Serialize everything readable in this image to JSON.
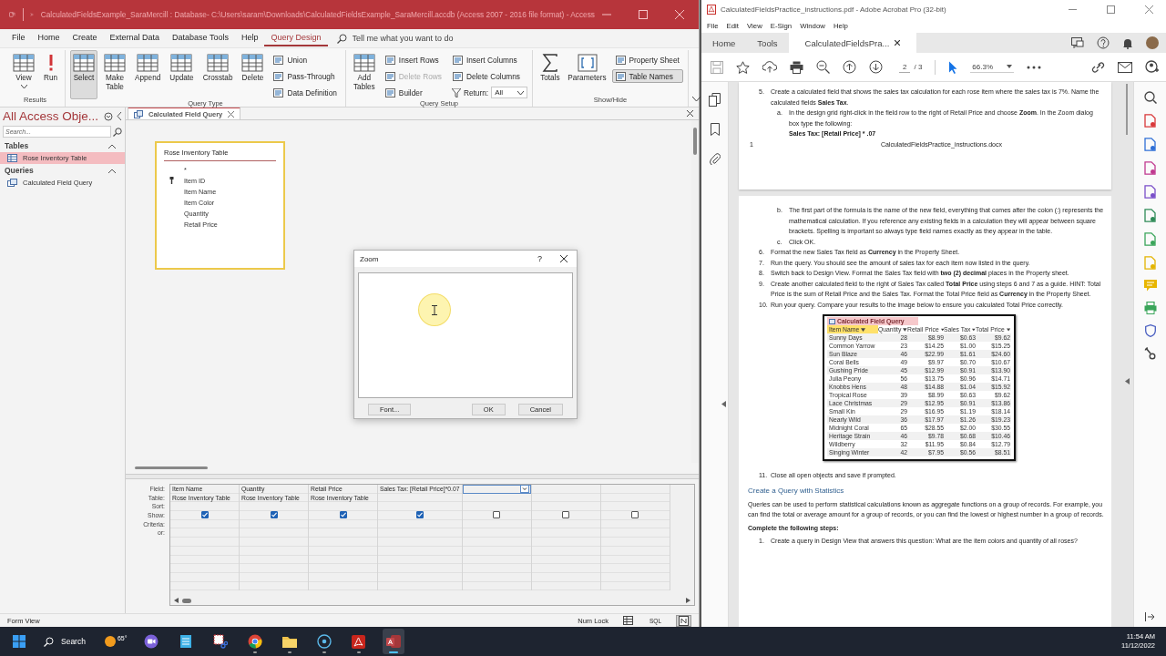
{
  "access": {
    "title": "CalculatedFieldsExample_SaraMercill : Database- C:\\Users\\saram\\Downloads\\CalculatedFieldsExample_SaraMercill.accdb (Access 2007 - 2016 file format)  -  Access",
    "ribbon_tabs": [
      {
        "label": "File",
        "selected": false
      },
      {
        "label": "Home",
        "selected": false
      },
      {
        "label": "Create",
        "selected": false
      },
      {
        "label": "External Data",
        "selected": false
      },
      {
        "label": "Database Tools",
        "selected": false
      },
      {
        "label": "Help",
        "selected": false
      },
      {
        "label": "Query Design",
        "selected": true
      }
    ],
    "tell_me": {
      "placeholder": "Tell me what you want to do"
    },
    "ribbon_groups": [
      {
        "label": "Results",
        "items": [
          {
            "label": "View",
            "kind": "view",
            "selected": false,
            "disabled": false
          },
          {
            "label": "Run",
            "kind": "alert",
            "selected": false,
            "disabled": false
          }
        ]
      },
      {
        "label": "Query Type",
        "items": [
          {
            "label": "Select",
            "kind": "grid",
            "selected": true,
            "disabled": false
          },
          {
            "label": "Make Table",
            "kind": "grid",
            "selected": false,
            "disabled": false
          },
          {
            "label": "Append",
            "kind": "grid",
            "selected": false,
            "disabled": false
          },
          {
            "label": "Update",
            "kind": "grid",
            "selected": false,
            "disabled": false
          },
          {
            "label": "Crosstab",
            "kind": "grid",
            "selected": false,
            "disabled": false
          },
          {
            "label": "Delete",
            "kind": "grid",
            "selected": false,
            "disabled": false
          },
          {
            "label": "Union",
            "kind": "small",
            "selected": false,
            "disabled": false
          },
          {
            "label": "Pass-Through",
            "kind": "small",
            "selected": false,
            "disabled": false
          },
          {
            "label": "Data Definition",
            "kind": "small",
            "selected": false,
            "disabled": false
          }
        ]
      },
      {
        "label": "Query Setup",
        "items": [
          {
            "label": "Add Tables",
            "kind": "grid",
            "selected": false,
            "disabled": false
          },
          {
            "label": "Insert Rows",
            "kind": "small",
            "selected": false,
            "disabled": false
          },
          {
            "label": "Delete Rows",
            "kind": "small",
            "selected": false,
            "disabled": true
          },
          {
            "label": "Builder",
            "kind": "small",
            "selected": false,
            "disabled": false
          },
          {
            "label": "Insert Columns",
            "kind": "small",
            "selected": false,
            "disabled": false
          },
          {
            "label": "Delete Columns",
            "kind": "small",
            "selected": false,
            "disabled": false
          },
          {
            "label": "Return:",
            "kind": "select",
            "value": "All",
            "selected": false,
            "disabled": false
          }
        ]
      },
      {
        "label": "Show/Hide",
        "items": [
          {
            "label": "Totals",
            "kind": "sum",
            "selected": false,
            "disabled": false
          },
          {
            "label": "Parameters",
            "kind": "form",
            "selected": false,
            "disabled": false
          },
          {
            "label": "Property Sheet",
            "kind": "small",
            "selected": false,
            "disabled": false
          },
          {
            "label": "Table Names",
            "kind": "small",
            "selected": true,
            "disabled": false
          }
        ]
      }
    ],
    "nav": {
      "title": "All Access Obje...",
      "search": {
        "placeholder": "Search..."
      },
      "groups": [
        {
          "label": "Tables",
          "expanded": true,
          "items": [
            {
              "label": "Rose Inventory Table",
              "selected": true
            }
          ]
        },
        {
          "label": "Queries",
          "expanded": true,
          "items": [
            {
              "label": "Calculated Field Query",
              "selected": false
            }
          ]
        }
      ]
    },
    "doc_tab": {
      "label": "Calculated Field Query"
    },
    "field_list": {
      "title": "Rose Inventory Table",
      "fields": [
        {
          "name": "*",
          "key": false
        },
        {
          "name": "Item ID",
          "key": true
        },
        {
          "name": "Item Name",
          "key": false
        },
        {
          "name": "Item Color",
          "key": false
        },
        {
          "name": "Quantity",
          "key": false
        },
        {
          "name": "Retail Price",
          "key": false
        }
      ]
    },
    "zoom_dialog": {
      "title": "Zoom",
      "help": "?",
      "font_button": "Font...",
      "ok_button": "OK",
      "cancel_button": "Cancel"
    },
    "grid": {
      "row_labels": [
        "Field:",
        "Table:",
        "Sort:",
        "Show:",
        "Criteria:",
        "or:"
      ],
      "columns": [
        {
          "field": "Item Name",
          "table": "Rose Inventory Table",
          "show": true,
          "selected": false
        },
        {
          "field": "Quantity",
          "table": "Rose Inventory Table",
          "show": true,
          "selected": false
        },
        {
          "field": "Retail Price",
          "table": "Rose Inventory Table",
          "show": true,
          "selected": false
        },
        {
          "field": "Sales Tax: [Retail Price]*0.07",
          "show": true,
          "selected": false
        },
        {
          "show": false,
          "selected": true
        },
        {
          "show": false,
          "selected": false
        },
        {
          "show": false,
          "selected": false
        }
      ]
    },
    "status": {
      "text": "Form View",
      "num_lock": "Num Lock",
      "views": [
        {
          "kind": "datasheet",
          "selected": false
        },
        {
          "kind": "sql",
          "label": "SQL",
          "selected": false
        },
        {
          "kind": "design",
          "selected": true
        }
      ]
    }
  },
  "acrobat": {
    "title": "CalculatedFieldsPractice_instructions.pdf - Adobe Acrobat Pro (32-bit)",
    "menu": [
      "File",
      "Edit",
      "View",
      "E-Sign",
      "Window",
      "Help"
    ],
    "tabs": [
      {
        "label": "Home",
        "selected": false
      },
      {
        "label": "Tools",
        "selected": false
      },
      {
        "label": "CalculatedFieldsPra...",
        "selected": true
      }
    ],
    "page_number": "2",
    "page_total": "/ 3",
    "zoom": "66.3%",
    "page1": {
      "items": [
        {
          "marker": "5.",
          "text": "Create a calculated field that shows the sales tax calculation for each rose item where the sales tax is 7%. Name the calculated fields **Sales Tax**.",
          "children": [
            {
              "marker": "a.",
              "text": "In the design grid right-click in the field row to the right of Retail Price and choose **Zoom**. In the Zoom dialog box type the following:",
              "formula": "Sales Tax: [Retail Price] * .07"
            }
          ]
        }
      ],
      "footer_number": "1",
      "footer_file": "CalculatedFieldsPractice_instructions.docx"
    },
    "page2": {
      "continued": [
        {
          "marker": "b.",
          "text": "The first part of the formula is the name of the new field, everything that comes after the colon (:) represents the mathematical calculation. If you reference any existing fields in a calculation they will appear between square brackets. Spelling is important so always type field names exactly as they appear in the table."
        },
        {
          "marker": "c.",
          "text": "Click OK."
        }
      ],
      "items": [
        {
          "marker": "6.",
          "text": "Format the new Sales Tax field as **Currency** in the Property Sheet."
        },
        {
          "marker": "7.",
          "text": "Run the query. You should see the amount of sales tax for each item now listed in the query."
        },
        {
          "marker": "8.",
          "text": "Switch back to Design View. Format the Sales Tax field with **two (2) decimal** places in the Property sheet."
        },
        {
          "marker": "9.",
          "text": "Create another calculated field to the right of Sales Tax called **Total Price** using steps 6 and 7 as a guide. HINT: Total Price is the sum of Retail Price and the Sales Tax. Format the Total Price field as **Currency** in the Property Sheet."
        },
        {
          "marker": "10.",
          "text": "Run your query. Compare your results to the image below to ensure you calculated Total Price correctly."
        }
      ],
      "result_image": {
        "tab": "Calculated Field Query",
        "columns": [
          {
            "label": "Item Name",
            "selected": true
          },
          {
            "label": "Quantity",
            "selected": false
          },
          {
            "label": "Retail Price",
            "selected": false
          },
          {
            "label": "Sales Tax",
            "selected": false
          },
          {
            "label": "Total Price",
            "selected": false
          }
        ],
        "rows": [
          [
            "Sunny Days",
            "28",
            "$8.99",
            "$0.63",
            "$9.62"
          ],
          [
            "Common Yarrow",
            "23",
            "$14.25",
            "$1.00",
            "$15.25"
          ],
          [
            "Sun Blaze",
            "46",
            "$22.99",
            "$1.61",
            "$24.60"
          ],
          [
            "Coral Bells",
            "49",
            "$9.97",
            "$0.70",
            "$10.67"
          ],
          [
            "Gushing Pride",
            "45",
            "$12.99",
            "$0.91",
            "$13.90"
          ],
          [
            "Julia Peony",
            "56",
            "$13.75",
            "$0.96",
            "$14.71"
          ],
          [
            "Knobbs Hens",
            "48",
            "$14.88",
            "$1.04",
            "$15.92"
          ],
          [
            "Tropical Rose",
            "39",
            "$8.99",
            "$0.63",
            "$9.62"
          ],
          [
            "Lace Christmas",
            "29",
            "$12.95",
            "$0.91",
            "$13.86"
          ],
          [
            "Small Kin",
            "29",
            "$16.95",
            "$1.19",
            "$18.14"
          ],
          [
            "Nearly Wild",
            "36",
            "$17.97",
            "$1.26",
            "$19.23"
          ],
          [
            "Midnight Coral",
            "65",
            "$28.55",
            "$2.00",
            "$30.55"
          ],
          [
            "Heritage Strain",
            "46",
            "$9.78",
            "$0.68",
            "$10.46"
          ],
          [
            "Wildberry",
            "32",
            "$11.95",
            "$0.84",
            "$12.79"
          ],
          [
            "Singing Winter",
            "42",
            "$7.95",
            "$0.56",
            "$8.51"
          ]
        ]
      },
      "after": {
        "marker": "11.",
        "text": "Close all open objects and save if prompted."
      },
      "heading": "Create a Query with Statistics",
      "paragraph": "Queries can be used to perform statistical calculations known as aggregate functions on a group of records. For example, you can find the total or average amount for a group of records, or you can find the lowest or highest number in a group of records.",
      "lead": "Complete the following steps:",
      "steps": [
        {
          "marker": "1.",
          "text": "Create a query in Design View that answers this question: What are the item colors and quantity of all roses?"
        }
      ]
    }
  },
  "taskbar": {
    "search": "Search",
    "weather": "65°",
    "time": "11:54 AM",
    "date": "11/12/2022",
    "apps": [
      {
        "kind": "meet",
        "running": false,
        "selected": false
      },
      {
        "kind": "notes",
        "running": false,
        "selected": false
      },
      {
        "kind": "snip",
        "running": false,
        "selected": false
      },
      {
        "kind": "browser",
        "running": true,
        "selected": false
      },
      {
        "kind": "folder",
        "running": true,
        "selected": false
      },
      {
        "kind": "disc",
        "running": true,
        "selected": false
      },
      {
        "kind": "pdf",
        "running": true,
        "selected": false
      },
      {
        "kind": "database",
        "running": true,
        "selected": true
      }
    ]
  }
}
